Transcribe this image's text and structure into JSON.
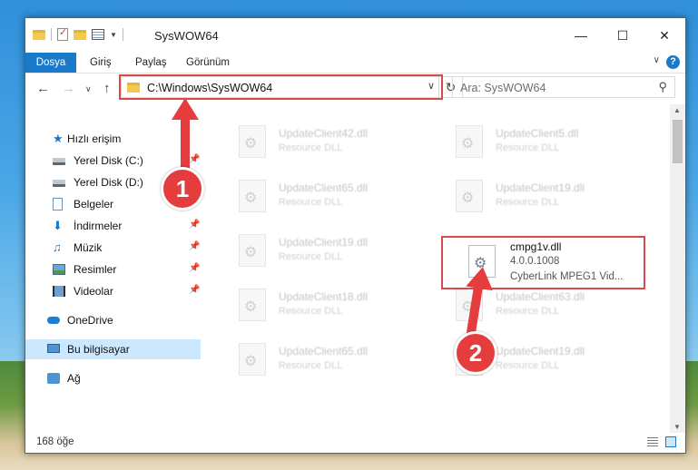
{
  "window": {
    "title": "SysWOW64"
  },
  "ribbon": {
    "tabs": [
      "Dosya",
      "Giriş",
      "Paylaş",
      "Görünüm"
    ],
    "help": "?"
  },
  "nav": {
    "address": "C:\\Windows\\SysWOW64",
    "search_placeholder": "Ara: SysWOW64"
  },
  "sidebar": {
    "items": [
      {
        "label": "Hızlı erişim",
        "icon": "star-icon"
      },
      {
        "label": "Yerel Disk (C:)",
        "icon": "disk-icon"
      },
      {
        "label": "Yerel Disk (D:)",
        "icon": "disk-icon"
      },
      {
        "label": "Belgeler",
        "icon": "documents-icon"
      },
      {
        "label": "İndirmeler",
        "icon": "downloads-icon"
      },
      {
        "label": "Müzik",
        "icon": "music-icon"
      },
      {
        "label": "Resimler",
        "icon": "pictures-icon"
      },
      {
        "label": "Videolar",
        "icon": "videos-icon"
      },
      {
        "label": "OneDrive",
        "icon": "onedrive-icon"
      },
      {
        "label": "Bu bilgisayar",
        "icon": "computer-icon"
      },
      {
        "label": "Ağ",
        "icon": "network-icon"
      }
    ]
  },
  "files": [
    {
      "name": "UpdateClient42.dll",
      "type": "Resource DLL"
    },
    {
      "name": "UpdateClient5.dll",
      "type": "Resource DLL"
    },
    {
      "name": "UpdateClient65.dll",
      "type": "Resource DLL"
    },
    {
      "name": "UpdateClient19.dll",
      "type": "Resource DLL"
    },
    {
      "name": "UpdateClient19.dll",
      "type": "Resource DLL"
    },
    {
      "name": "cmpg1v.dll",
      "version": "4.0.0.1008",
      "type": "CyberLink MPEG1 Vid..."
    },
    {
      "name": "UpdateClient18.dll",
      "type": "Resource DLL"
    },
    {
      "name": "UpdateClient63.dll",
      "type": "Resource DLL"
    },
    {
      "name": "UpdateClient65.dll",
      "type": "Resource DLL"
    },
    {
      "name": "UpdateClient19.dll",
      "type": "Resource DLL"
    }
  ],
  "status": {
    "count": "168 öğe"
  },
  "callouts": [
    "1",
    "2"
  ],
  "colors": {
    "accent": "#1979ca",
    "callout": "#e53d3d",
    "selected": "#cce8ff"
  }
}
